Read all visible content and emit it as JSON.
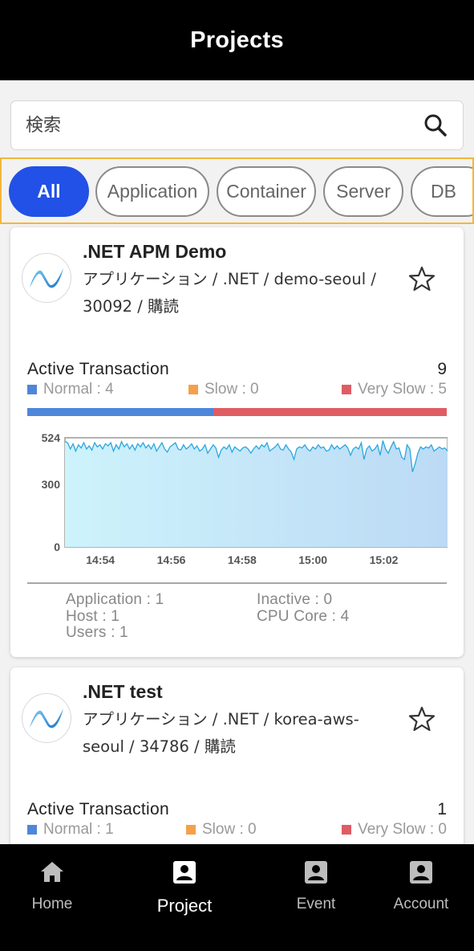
{
  "header": {
    "title": "Projects"
  },
  "search": {
    "placeholder": "検索"
  },
  "filters": [
    "All",
    "Application",
    "Container",
    "Server",
    "DB"
  ],
  "cards": [
    {
      "title": ".NET APM Demo",
      "meta": "アプリケーション / .NET / demo-seoul / 30092 / 購読",
      "active_transaction_label": "Active Transaction",
      "active_transaction_count": "9",
      "legend": {
        "normal": "Normal : 4",
        "slow": "Slow : 0",
        "very_slow": "Very Slow : 5"
      },
      "bar": {
        "normal": 4,
        "slow": 0,
        "very_slow": 5
      },
      "stats": {
        "application": "Application : 1",
        "host": "Host : 1",
        "users": "Users : 1",
        "inactive": "Inactive : 0",
        "cpu_core": "CPU Core : 4"
      }
    },
    {
      "title": ".NET test",
      "meta": "アプリケーション / .NET / korea-aws-seoul / 34786 / 購読",
      "active_transaction_label": "Active Transaction",
      "active_transaction_count": "1",
      "legend": {
        "normal": "Normal : 1",
        "slow": "Slow : 0",
        "very_slow": "Very Slow : 0"
      }
    }
  ],
  "colors": {
    "accent": "#2151e6",
    "normal": "#4f86d9",
    "slow": "#f5a04a",
    "very_slow": "#e05c63",
    "filter_border": "#f4b73a"
  },
  "chart_data": {
    "type": "area",
    "y_ticks": [
      "524",
      "300",
      "0"
    ],
    "ylim": [
      0,
      524
    ],
    "x_ticks": [
      "14:54",
      "14:56",
      "14:58",
      "15:00",
      "15:02"
    ],
    "x_tick_positions": [
      1,
      3,
      5,
      7,
      9
    ],
    "xlim": [
      0,
      10.8
    ],
    "values": [
      505,
      500,
      470,
      495,
      460,
      490,
      475,
      500,
      470,
      485,
      465,
      500,
      480,
      490,
      470,
      495,
      485,
      500,
      460,
      490,
      470,
      505,
      480,
      495,
      470,
      490,
      465,
      495,
      480,
      500,
      475,
      490,
      470,
      495,
      460,
      480,
      500,
      470,
      455,
      480,
      490,
      500,
      470,
      465,
      490,
      470,
      480,
      495,
      470,
      485,
      460,
      470,
      490,
      450,
      470,
      490,
      475,
      430,
      465,
      480,
      470,
      490,
      455,
      480,
      470,
      460,
      475,
      480,
      470,
      450,
      470,
      485,
      470,
      490,
      480,
      500,
      460,
      470,
      480,
      495,
      470,
      465,
      490,
      470,
      455,
      420,
      470,
      480,
      475,
      490,
      470,
      460,
      480,
      470,
      490,
      475,
      480,
      460,
      465,
      490,
      470,
      485,
      470,
      480,
      490,
      475,
      440,
      470,
      480,
      470,
      500,
      420,
      470,
      485,
      460,
      470,
      490,
      440,
      510,
      470,
      450,
      480,
      505,
      470,
      475,
      430,
      420,
      490,
      470,
      360,
      400,
      450,
      480,
      470,
      480,
      475,
      490,
      460,
      470,
      480,
      470,
      475,
      460
    ]
  },
  "tabbar": {
    "home": "Home",
    "project": "Project",
    "event": "Event",
    "account": "Account"
  }
}
